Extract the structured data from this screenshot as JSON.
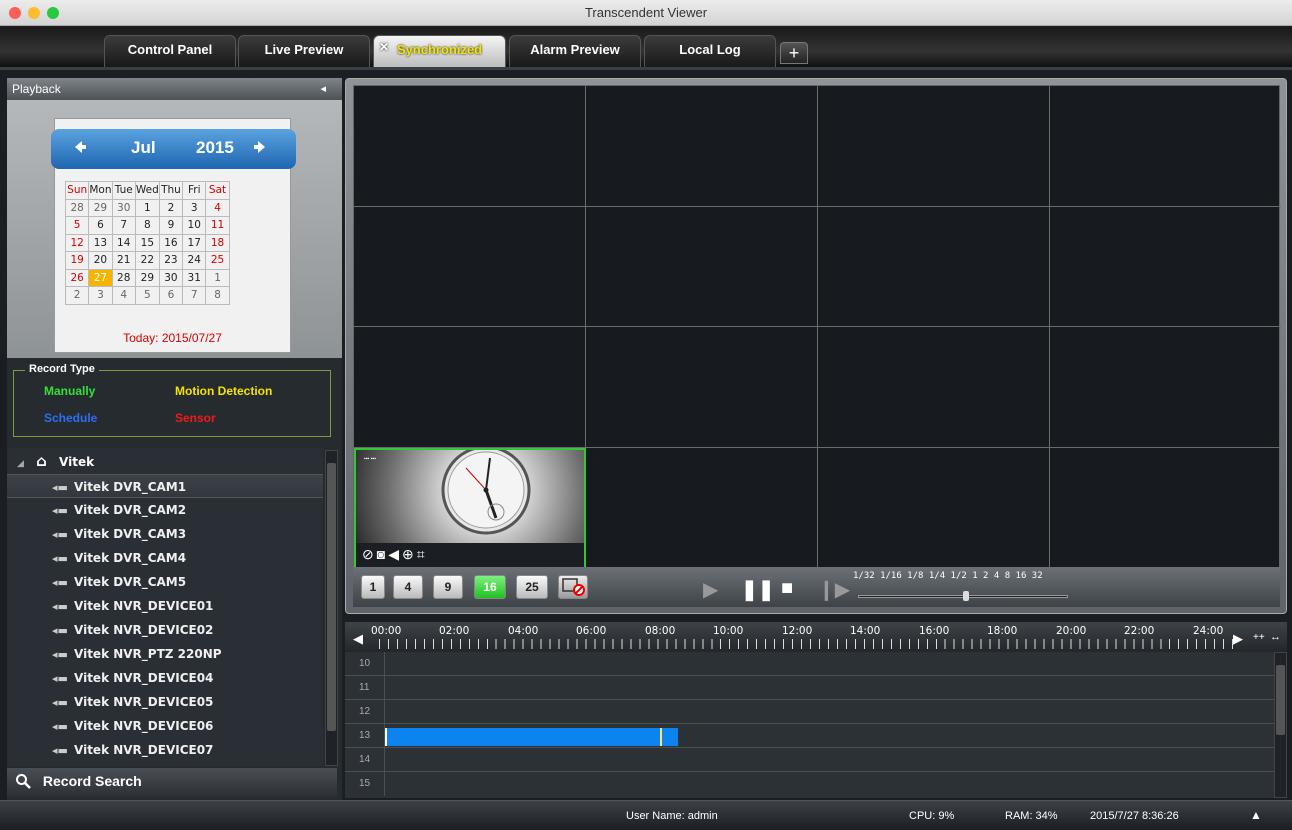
{
  "window": {
    "title": "Transcendent Viewer"
  },
  "tabs": [
    {
      "label": "Control Panel"
    },
    {
      "label": "Live Preview"
    },
    {
      "label": "Synchronized",
      "active": true
    },
    {
      "label": "Alarm Preview"
    },
    {
      "label": "Local Log"
    }
  ],
  "add_tab_label": "+",
  "playback": {
    "header": "Playback",
    "collapse_icon": "◂",
    "calendar": {
      "month": "Jul",
      "year": "2015",
      "prev_icon": "arrow-left-icon",
      "next_icon": "arrow-right-icon",
      "weekdays": [
        "Sun",
        "Mon",
        "Tue",
        "Wed",
        "Thu",
        "Fri",
        "Sat"
      ],
      "weeks": [
        [
          "28",
          "29",
          "30",
          "1",
          "2",
          "3",
          "4"
        ],
        [
          "5",
          "6",
          "7",
          "8",
          "9",
          "10",
          "11"
        ],
        [
          "12",
          "13",
          "14",
          "15",
          "16",
          "17",
          "18"
        ],
        [
          "19",
          "20",
          "21",
          "22",
          "23",
          "24",
          "25"
        ],
        [
          "26",
          "27",
          "28",
          "29",
          "30",
          "31",
          "1"
        ],
        [
          "2",
          "3",
          "4",
          "5",
          "6",
          "7",
          "8"
        ]
      ],
      "selected_day": "27",
      "today_label": "Today: 2015/07/27"
    }
  },
  "record_type": {
    "title": "Record Type",
    "manually": "Manually",
    "motion": "Motion Detection",
    "schedule": "Schedule",
    "sensor": "Sensor",
    "colors": {
      "manually": "#35e035",
      "motion": "#f5e300",
      "schedule": "#2f6df0",
      "sensor": "#f01a1a"
    }
  },
  "device_tree": {
    "root": "Vitek",
    "items": [
      "Vitek DVR_CAM1",
      "Vitek DVR_CAM2",
      "Vitek DVR_CAM3",
      "Vitek DVR_CAM4",
      "Vitek DVR_CAM5",
      "Vitek NVR_DEVICE01",
      "Vitek NVR_DEVICE02",
      "Vitek NVR_PTZ 220NP",
      "Vitek NVR_DEVICE04",
      "Vitek NVR_DEVICE05",
      "Vitek NVR_DEVICE06",
      "Vitek NVR_DEVICE07"
    ],
    "selected_index": 0
  },
  "record_search": {
    "label": "Record Search"
  },
  "layouts": [
    "1",
    "4",
    "9",
    "16",
    "25"
  ],
  "active_layout": "16",
  "speed_labels": "1/32 1/16 1/8 1/4 1/2 1 2 4 8 16 32",
  "timeline": {
    "hours": [
      "00:00",
      "02:00",
      "04:00",
      "06:00",
      "08:00",
      "10:00",
      "12:00",
      "14:00",
      "16:00",
      "18:00",
      "20:00",
      "22:00",
      "24:00"
    ],
    "rows": [
      "10",
      "11",
      "12",
      "13",
      "14",
      "15"
    ],
    "record_row": "13",
    "zoom_in": "++",
    "zoom_out": "↔"
  },
  "status": {
    "user": "User Name: admin",
    "cpu": "CPU: 9%",
    "ram": "RAM: 34%",
    "datetime": "2015/7/27 8:36:26"
  }
}
